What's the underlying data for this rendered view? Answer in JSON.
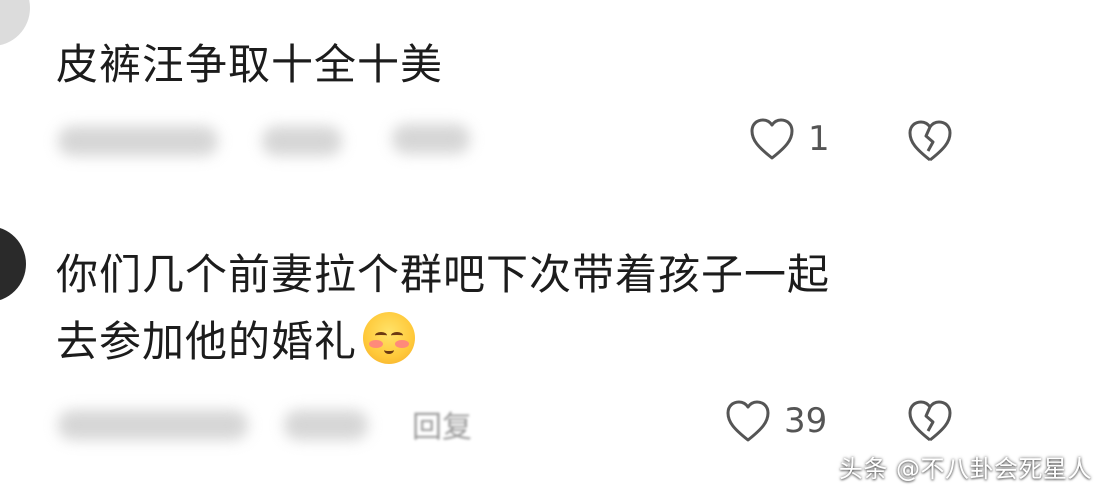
{
  "comments": [
    {
      "text": "皮裤汪争取十全十美",
      "like_count": "1",
      "like_icon": "heart-outline-icon",
      "dislike_icon": "broken-heart-icon"
    },
    {
      "text_line1": "你们几个前妻拉个群吧下次带着孩子一起",
      "text_line2": "去参加他的婚礼",
      "emoji_icon": "smirk-blush-emoji-icon",
      "reply_label": "回复",
      "like_count": "39",
      "like_icon": "heart-outline-icon",
      "dislike_icon": "broken-heart-icon"
    }
  ],
  "watermark": "头条 @不八卦会死星人"
}
